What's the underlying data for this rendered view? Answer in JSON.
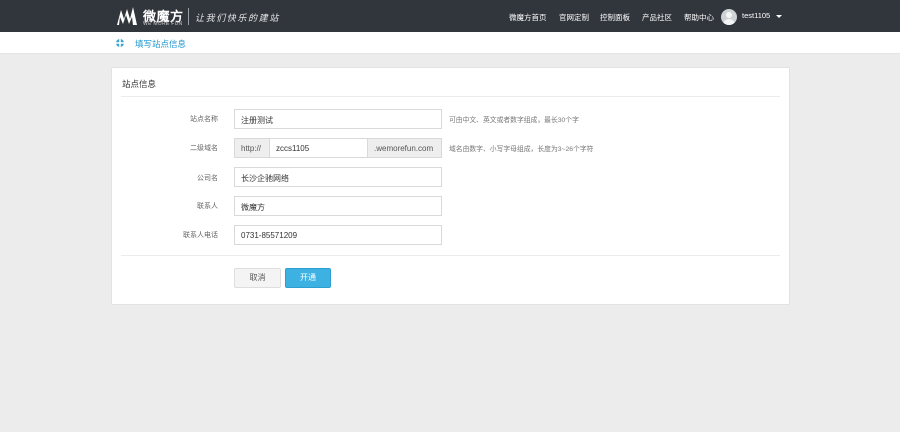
{
  "header": {
    "brand": "微魔方",
    "brand_sub": "WE MORE FUN",
    "slogan": "让我们快乐的建站",
    "nav": [
      "微魔方首页",
      "官网定制",
      "控制面板",
      "产品社区",
      "帮助中心"
    ],
    "username": "test1105"
  },
  "breadcrumb": {
    "title": "填写站点信息"
  },
  "form": {
    "title": "站点信息",
    "site_name": {
      "label": "站点名称",
      "value": "注册测试",
      "hint": "可由中文、英文或者数字组成，最长30个字"
    },
    "subdomain": {
      "label": "二级域名",
      "prefix": "http://",
      "value": "zccs1105",
      "suffix": ".wemorefun.com",
      "hint": "域名由数字、小写字母组成，长度为3~26个字符"
    },
    "company": {
      "label": "公司名",
      "value": "长沙企驰网络"
    },
    "contact": {
      "label": "联系人",
      "value": "微魔方"
    },
    "phone": {
      "label": "联系人电话",
      "value": "0731-85571209"
    },
    "cancel_label": "取消",
    "submit_label": "开通"
  },
  "colors": {
    "topbar": "#31363d",
    "accent": "#3cb1e2",
    "breadcrumb": "#1e96cc"
  }
}
